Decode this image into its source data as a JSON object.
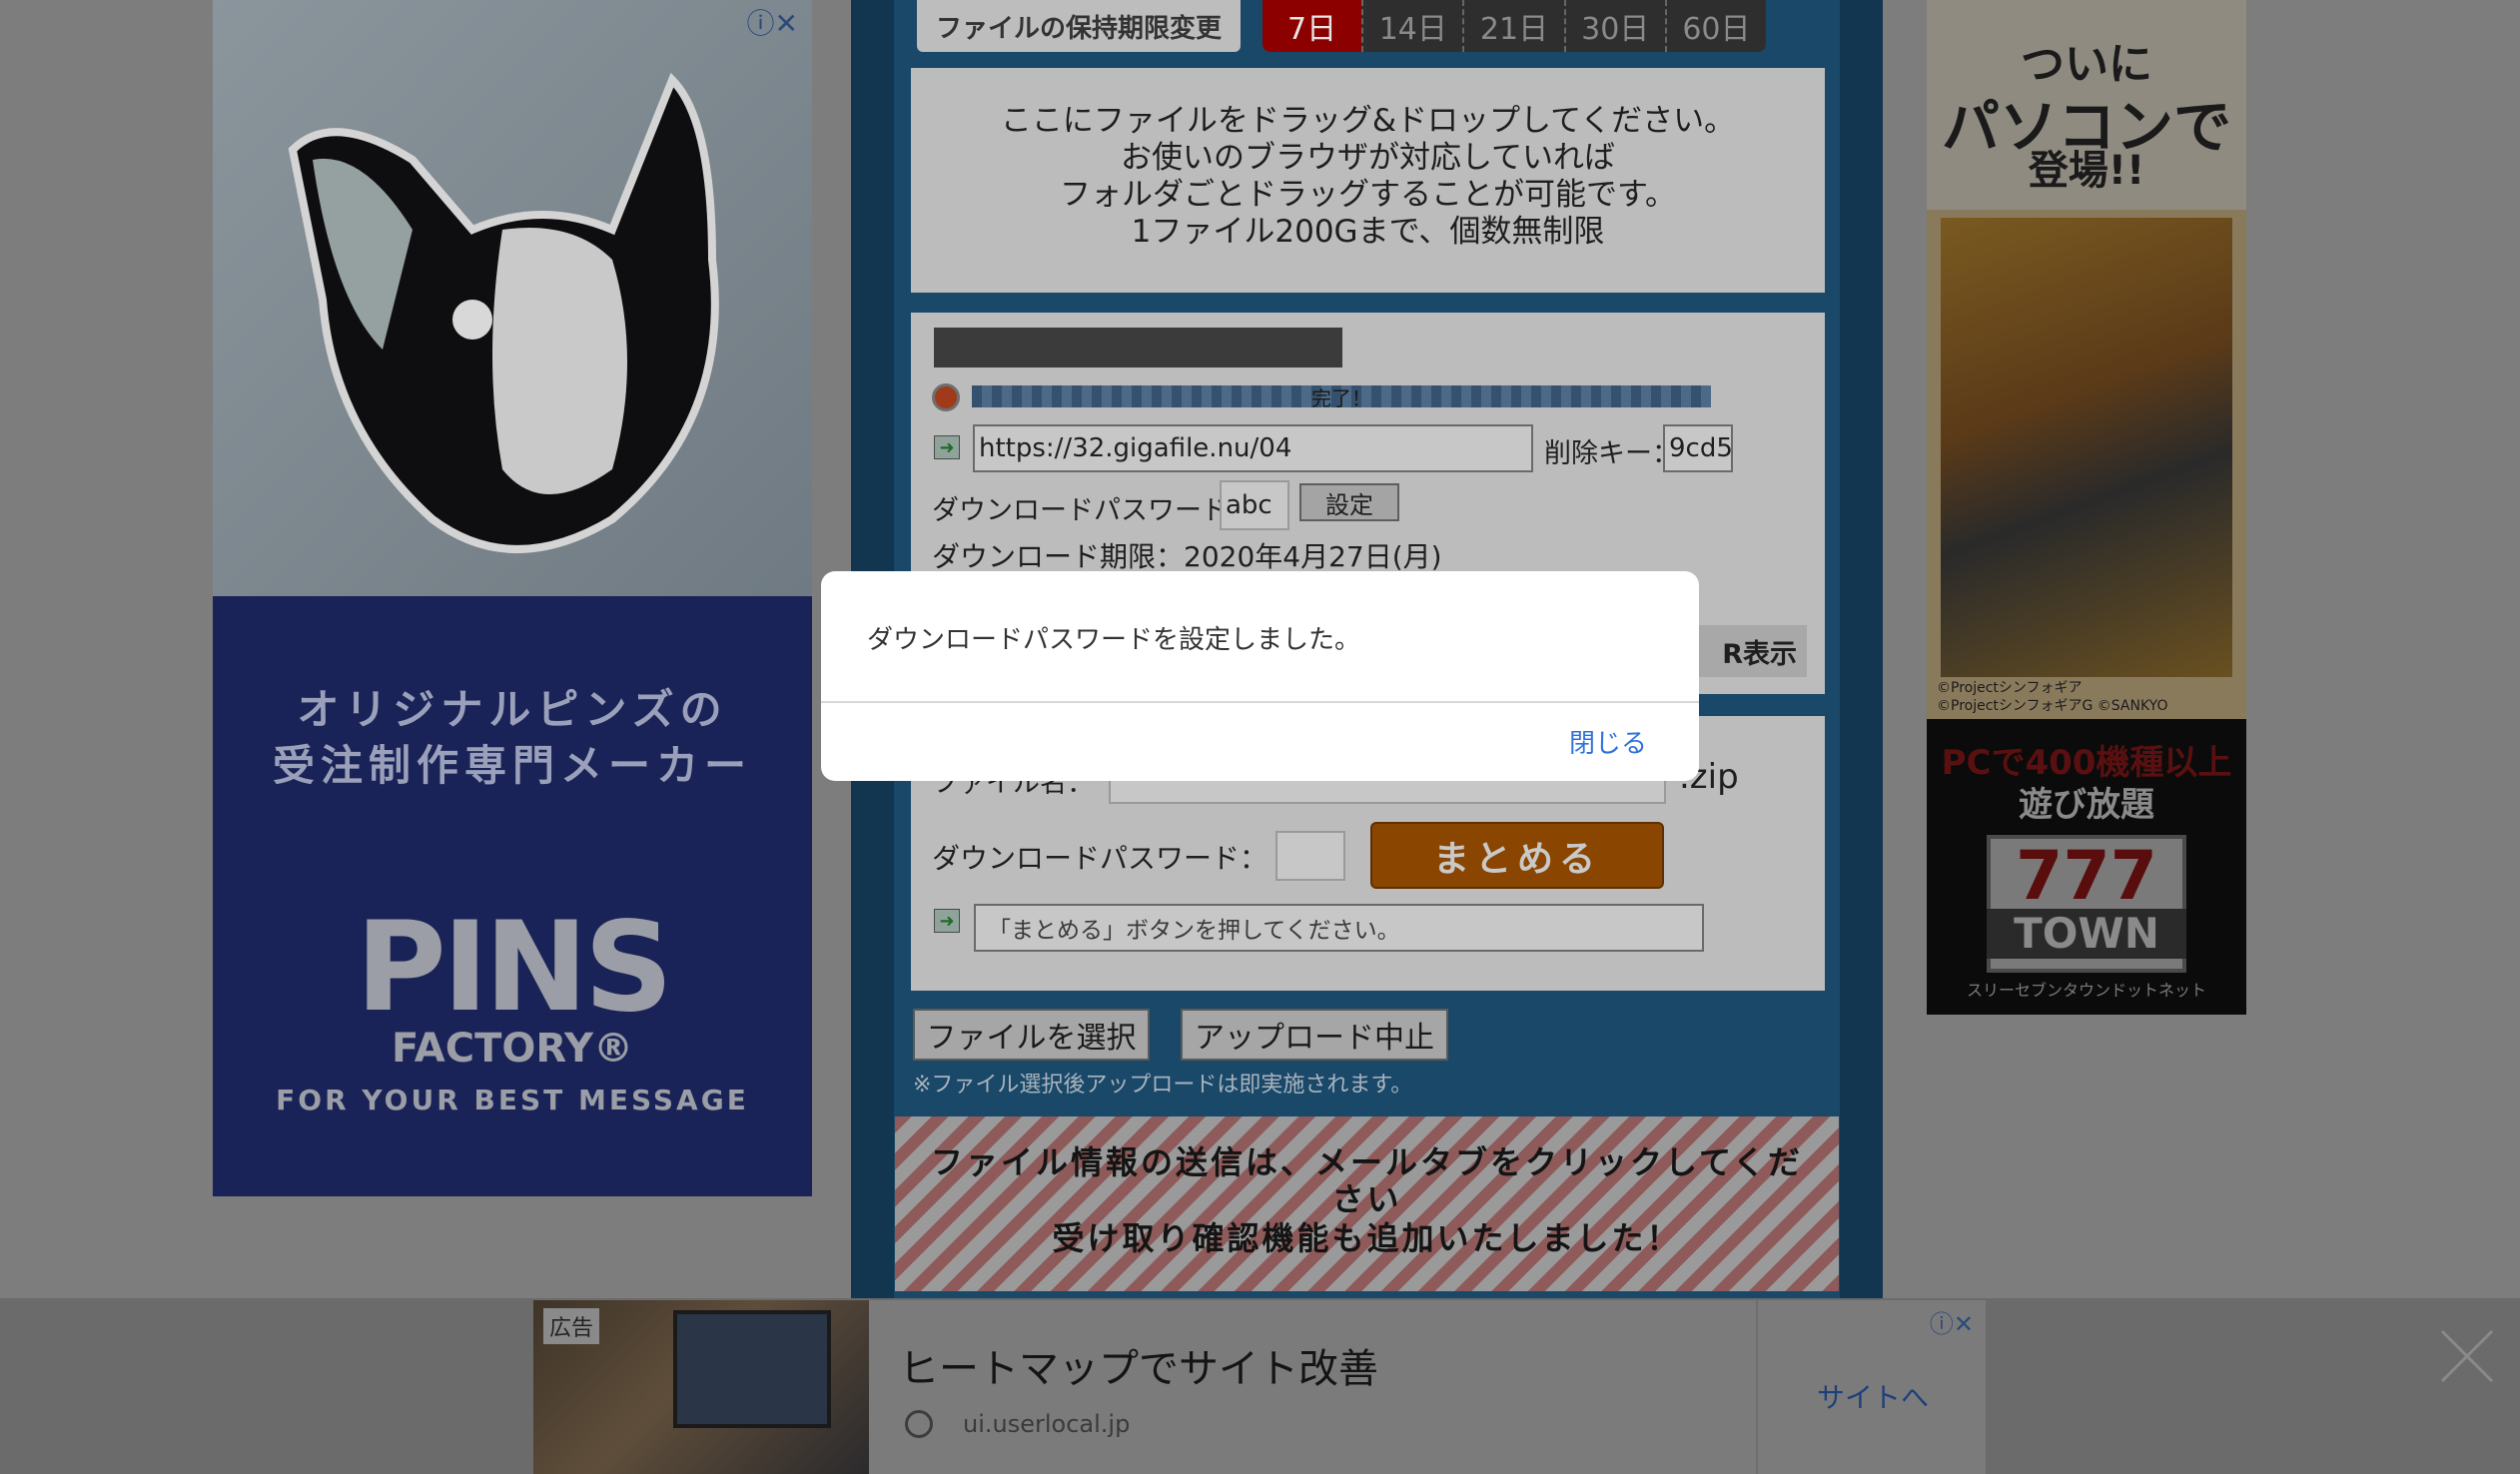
{
  "header": {
    "retention_label": "ファイルの保持期限変更",
    "days": [
      "7日",
      "14日",
      "21日",
      "30日",
      "60日"
    ],
    "active_day_index": 0
  },
  "dropzone": {
    "lines": [
      "ここにファイルをドラッグ&ドロップしてください。",
      "お使いのブラウザが対応していれば",
      "フォルダごとドラッグすることが可能です。",
      "1ファイル200Gまで、個数無制限"
    ]
  },
  "upload": {
    "progress_label": "完了！",
    "progress": 1.0,
    "url_value": "https://32.gigafile.nu/04",
    "delete_key_label": "削除キー：",
    "delete_key_value": "9cd5",
    "dl_password_label": "ダウンロードパスワード：",
    "dl_password_value": "abc",
    "set_button": "設定",
    "dl_deadline": "ダウンロード期限：2020年4月27日(月)",
    "qr_partial": "R表示"
  },
  "merge": {
    "filename_label": "ファイル名：",
    "zip_ext": ".zip",
    "dl_password_label": "ダウンロードパスワード：",
    "merge_button": "まとめる",
    "status_text": "「まとめる」ボタンを押してください。"
  },
  "actions": {
    "select_file": "ファイルを選択",
    "abort_upload": "アップロード中止",
    "note": "※ファイル選択後アップロードは即実施されます。"
  },
  "notice": {
    "line1": "ファイル情報の送信は、メールタブをクリックしてくだ",
    "line2": "さい",
    "line3": "受け取り確認機能も追加いたしました！"
  },
  "modal": {
    "message": "ダウンロードパスワードを設定しました。",
    "close": "閉じる"
  },
  "left_ad": {
    "tagline1": "オリジナルピンズの",
    "tagline2": "受注制作専門メーカー",
    "brand": "PINS",
    "brand_sub": "FACTORY®",
    "slogan": "FOR YOUR BEST MESSAGE"
  },
  "right_ad": {
    "headline1": "ついに",
    "headline2": "パソコンで",
    "headline3": "登場!!",
    "copyright1": "©Projectシンフォギア",
    "copyright2": "©ProjectシンフォギアG ©SANKYO",
    "pc_line": "PCで400機種以上",
    "play_line": "遊び放題",
    "logo_num": "777",
    "logo_word": "TOWN",
    "logo_sub": "スリーセブンタウンドットネット"
  },
  "bottom_ad": {
    "badge": "広告",
    "title": "ヒートマップでサイト改善",
    "domain": "ui.userlocal.jp",
    "cta": "サイトへ"
  },
  "colors": {
    "overlay_bg": "#7d7d7d",
    "active_day": "#8c0000",
    "merge_button": "#8a4600",
    "modal_link": "#2f73d9"
  }
}
